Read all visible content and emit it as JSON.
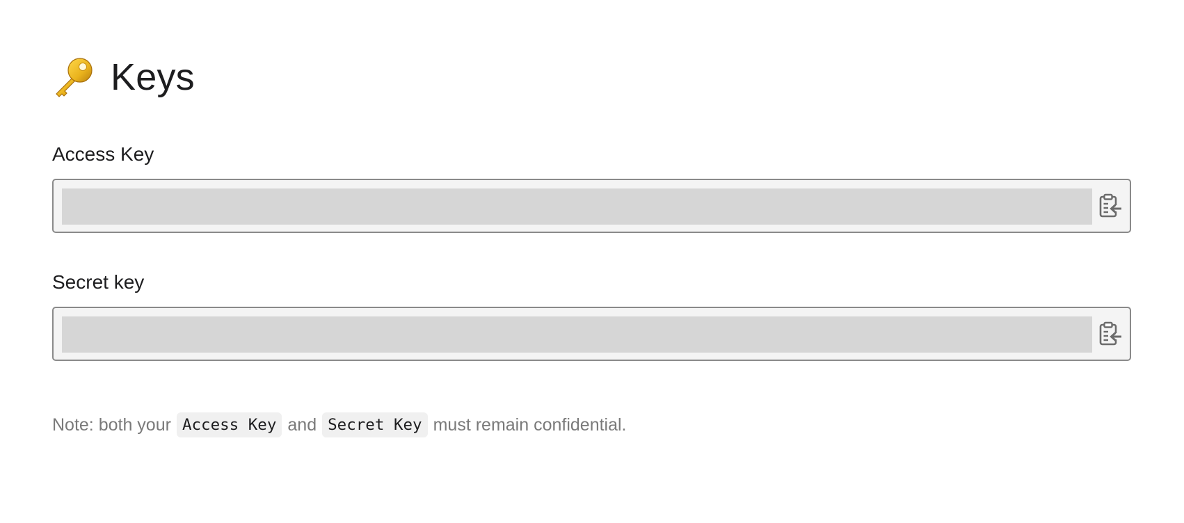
{
  "page": {
    "title": "Keys",
    "title_icon": "key-emoji-icon"
  },
  "fields": {
    "access": {
      "label": "Access Key",
      "value": "",
      "copy_icon": "paste-clipboard-icon"
    },
    "secret": {
      "label": "Secret key",
      "value": "",
      "copy_icon": "paste-clipboard-icon"
    }
  },
  "note": {
    "prefix": "Note: both your",
    "code1": "Access Key",
    "middle": "and",
    "code2": "Secret Key",
    "suffix": "must remain confidential."
  },
  "colors": {
    "field_border": "#8a8a8a",
    "field_background": "#f4f4f4",
    "value_placeholder_fill": "#d6d6d6",
    "note_text": "#7a7a7a",
    "code_background": "#f0f0f0",
    "key_gold": "#e9b21c"
  }
}
